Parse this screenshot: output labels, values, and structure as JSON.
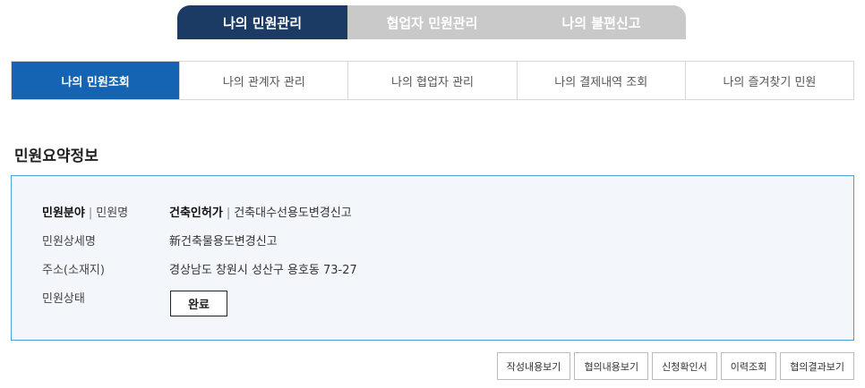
{
  "top_tabs": [
    {
      "label": "나의 민원관리"
    },
    {
      "label": "협업자 민원관리"
    },
    {
      "label": "나의 불편신고"
    }
  ],
  "sub_tabs": [
    {
      "label": "나의 민원조회"
    },
    {
      "label": "나의 관계자 관리"
    },
    {
      "label": "나의 협업자 관리"
    },
    {
      "label": "나의 결제내역 조회"
    },
    {
      "label": "나의 즐겨찾기 민원"
    }
  ],
  "summary": {
    "title": "민원요약정보",
    "field_label": "민원분야",
    "name_label": "민원명",
    "field_value": "건축인허가",
    "name_value": "건축대수선용도변경신고",
    "detail_label": "민원상세명",
    "detail_value": "新건축물용도변경신고",
    "address_label": "주소(소재지)",
    "address_value": "경상남도 창원시 성산구 용호동 73-27",
    "status_label": "민원상태",
    "status_value": "완료",
    "separator": "|"
  },
  "actions": [
    {
      "label": "작성내용보기"
    },
    {
      "label": "협의내용보기"
    },
    {
      "label": "신청확인서"
    },
    {
      "label": "이력조회"
    },
    {
      "label": "협의결과보기"
    }
  ]
}
